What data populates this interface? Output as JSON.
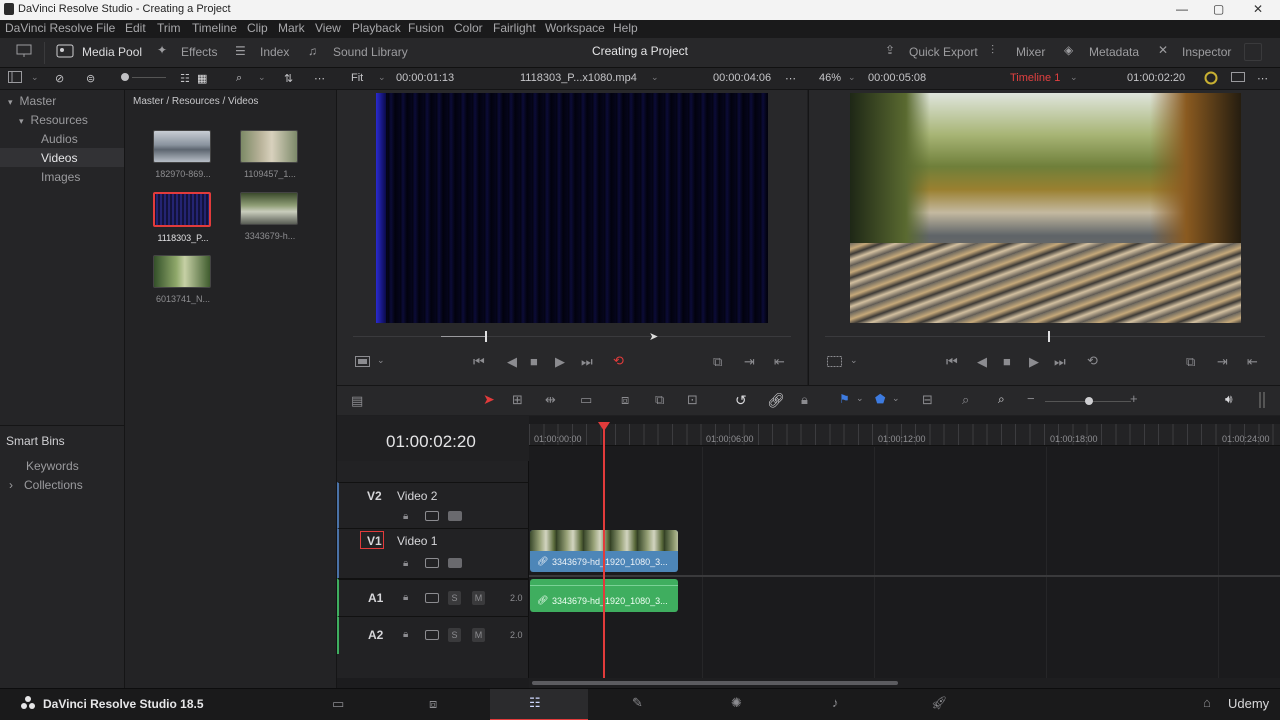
{
  "window": {
    "title": "DaVinci Resolve Studio - Creating a Project"
  },
  "menu": [
    "DaVinci Resolve",
    "File",
    "Edit",
    "Trim",
    "Timeline",
    "Clip",
    "Mark",
    "View",
    "Playback",
    "Fusion",
    "Color",
    "Fairlight",
    "Workspace",
    "Help"
  ],
  "toolbar": {
    "left": [
      "Media Pool",
      "Effects",
      "Index",
      "Sound Library"
    ],
    "project_title": "Creating a Project",
    "right": [
      "Quick Export",
      "Mixer",
      "Metadata",
      "Inspector"
    ]
  },
  "source_viewer": {
    "zoom": "Fit",
    "timecode_in": "00:00:01:13",
    "clip_name": "1118303_P...x1080.mp4",
    "duration": "00:00:04:06"
  },
  "program_viewer": {
    "zoom": "46%",
    "timecode_in": "00:00:05:08",
    "timeline_name": "Timeline 1",
    "timecode": "01:00:02:20"
  },
  "bins": {
    "tree": [
      {
        "label": "Master",
        "indent": 0,
        "arrow": "▾"
      },
      {
        "label": "Resources",
        "indent": 1,
        "arrow": "▾"
      },
      {
        "label": "Audios",
        "indent": 2,
        "arrow": ""
      },
      {
        "label": "Videos",
        "indent": 2,
        "arrow": "",
        "selected": true
      },
      {
        "label": "Images",
        "indent": 2,
        "arrow": ""
      }
    ],
    "smart_bins_title": "Smart Bins",
    "smart_bins": [
      {
        "label": "Keywords",
        "arrow": ""
      },
      {
        "label": "Collections",
        "arrow": "›"
      }
    ]
  },
  "media_pool": {
    "breadcrumb": "Master / Resources / Videos",
    "clips": [
      {
        "name": "182970-869...",
        "colors": [
          "#9fa7b3",
          "#5a6470"
        ]
      },
      {
        "name": "1109457_1...",
        "colors": [
          "#8f9a7a",
          "#c9c2a8"
        ]
      },
      {
        "name": "1118303_P...",
        "colors": [
          "#0b0b2a",
          "#3a3aa0"
        ],
        "selected": true
      },
      {
        "name": "3343679-h...",
        "colors": [
          "#6d7f5a",
          "#aab49a"
        ]
      },
      {
        "name": "6013741_N...",
        "colors": [
          "#4d6a3a",
          "#a9b98a"
        ]
      }
    ]
  },
  "timeline": {
    "timecode": "01:00:02:20",
    "ruler": [
      "01:00:00:00",
      "01:00:06:00",
      "01:00:12:00",
      "01:00:18:00",
      "01:00:24:00"
    ],
    "tracks": [
      {
        "id": "V2",
        "name": "Video 2"
      },
      {
        "id": "V1",
        "name": "Video 1"
      },
      {
        "id": "A1",
        "name": "",
        "level": "2.0"
      },
      {
        "id": "A2",
        "name": "",
        "level": "2.0"
      }
    ],
    "video_clip": "3343679-hd_1920_1080_3...",
    "audio_clip": "3343679-hd_1920_1080_3...",
    "solo": "S",
    "mute": "M"
  },
  "bottom": {
    "app_name": "DaVinci Resolve Studio 18.5",
    "watermark": "Udemy"
  },
  "colors": {
    "accent_red": "#e23b3b",
    "clip_blue": "#4d86b8",
    "clip_green": "#3fae5f"
  }
}
